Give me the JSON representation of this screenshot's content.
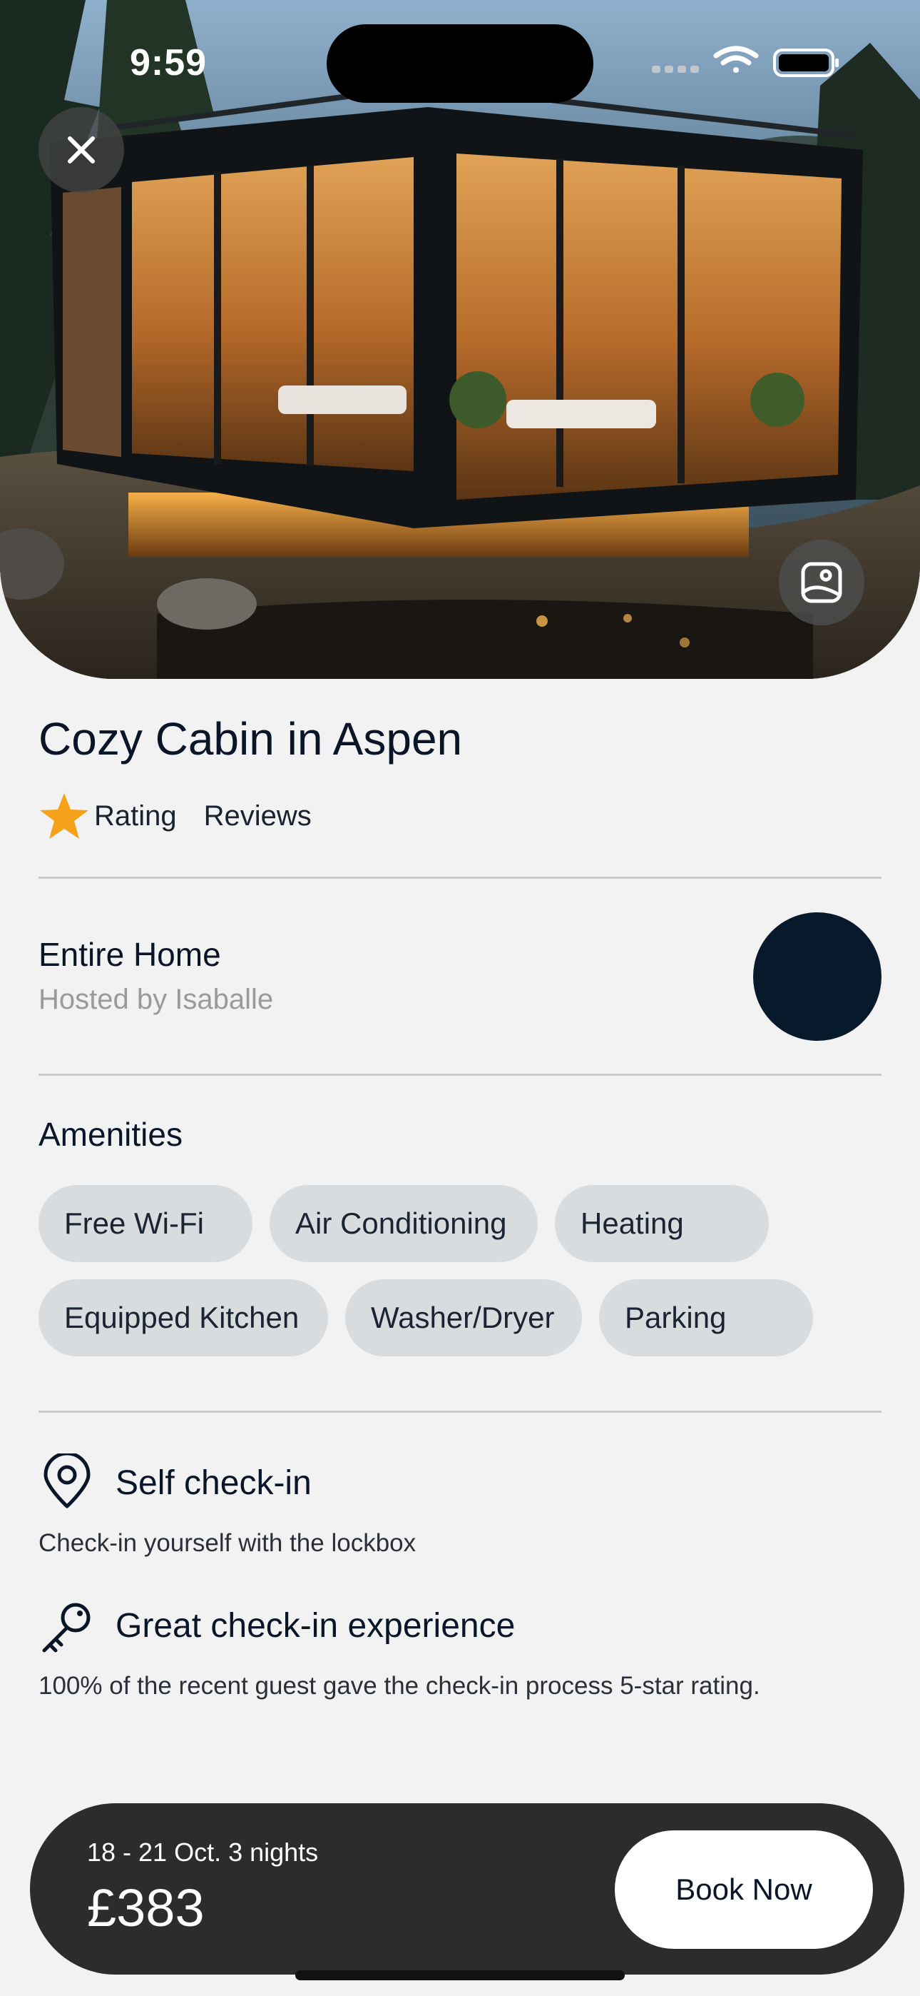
{
  "status_bar": {
    "time": "9:59",
    "icons": [
      "signal-icon",
      "wifi-icon",
      "battery-icon"
    ]
  },
  "hero": {
    "close_icon": "close-icon",
    "gallery_icon": "image-gallery-icon"
  },
  "listing": {
    "title": "Cozy Cabin in Aspen",
    "rating_label": "Rating",
    "reviews_label": "Reviews",
    "star_color": "#f5a11a"
  },
  "host": {
    "type": "Entire Home",
    "hosted_by": "Hosted by Isaballe",
    "avatar_color": "#061a2c"
  },
  "amenities": {
    "title": "Amenities",
    "items": [
      "Free Wi-Fi",
      "Air Conditioning",
      "Heating",
      "Equipped Kitchen",
      "Washer/Dryer",
      "Parking"
    ]
  },
  "features": [
    {
      "icon": "location-pin-icon",
      "title": "Self check-in",
      "description": "Check-in yourself with the lockbox"
    },
    {
      "icon": "key-icon",
      "title": "Great check-in experience",
      "description": "100% of the recent guest gave the check-in process  5-star rating."
    }
  ],
  "booking": {
    "dates": "18 - 21 Oct. 3 nights",
    "price": "£383",
    "button_label": "Book Now"
  }
}
